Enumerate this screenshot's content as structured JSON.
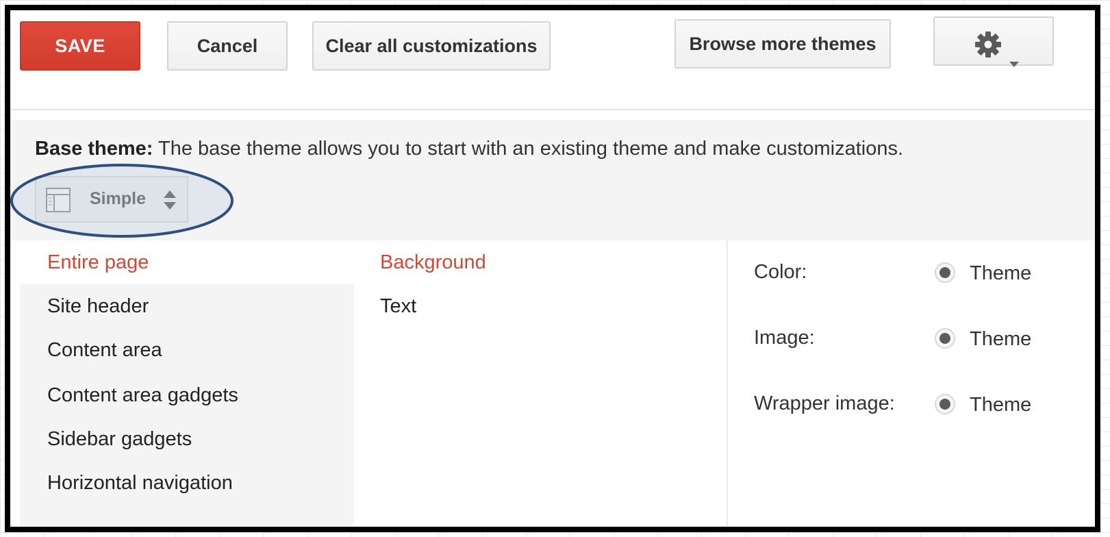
{
  "toolbar": {
    "save_label": "SAVE",
    "cancel_label": "Cancel",
    "clear_label": "Clear all customizations",
    "browse_label": "Browse more themes",
    "gear_icon": "gear-icon",
    "caret_icon": "caret-down-icon"
  },
  "base_theme": {
    "label": "Base theme:",
    "description": " The base theme allows you to start with an existing theme and make customizations.",
    "selected": "Simple",
    "thumb_icon": "layout-thumbnail-icon",
    "updown_icon": "up-down-arrows-icon",
    "highlight_color": "#2f4f7f"
  },
  "sections": [
    {
      "label": "Entire page",
      "active": true
    },
    {
      "label": "Site header",
      "active": false
    },
    {
      "label": "Content area",
      "active": false
    },
    {
      "label": "Content area gadgets",
      "active": false
    },
    {
      "label": "Sidebar gadgets",
      "active": false
    },
    {
      "label": "Horizontal navigation",
      "active": false
    }
  ],
  "properties": [
    {
      "label": "Background",
      "active": true
    },
    {
      "label": "Text",
      "active": false
    }
  ],
  "options": [
    {
      "label": "Color:",
      "value": "Theme",
      "selected": true
    },
    {
      "label": "Image:",
      "value": "Theme",
      "selected": true
    },
    {
      "label": "Wrapper image:",
      "value": "Theme",
      "selected": true
    }
  ],
  "colors": {
    "accent": "#d14836",
    "save_button": "#d64332",
    "panel_background": "#f4f4f4"
  }
}
